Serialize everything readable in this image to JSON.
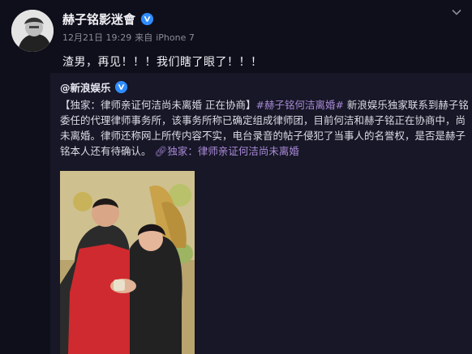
{
  "post": {
    "author": "赫子铭影迷會",
    "time": "12月21日 19:29",
    "source_prefix": "来自",
    "device": "iPhone 7",
    "text": "渣男，再见！！！我们瞎了眼了！！！"
  },
  "repost": {
    "author": "@新浪娱乐",
    "bracket_title": "【独家：律师亲证何洁尚未离婚 正在协商】",
    "hashtag": "#赫子铭何洁离婚#",
    "body": " 新浪娱乐独家联系到赫子铭委任的代理律师事务所，该事务所称已确定组成律师团，目前何洁和赫子铭正在协商中，尚未离婚。律师还称网上所传内容不实，电台录音的帖子侵犯了当事人的名誉权，是否是赫子铭本人还有待确认。",
    "link_text": "独家：律师亲证何洁尚未离婚"
  },
  "colors": {
    "background": "#0f0f1b",
    "card": "#171727",
    "accent": "#a98ad6",
    "verified_badge": "#2f8cff"
  },
  "icons": {
    "verified": "verified-badge-icon",
    "expand": "chevron-down-icon",
    "link": "link-icon"
  }
}
